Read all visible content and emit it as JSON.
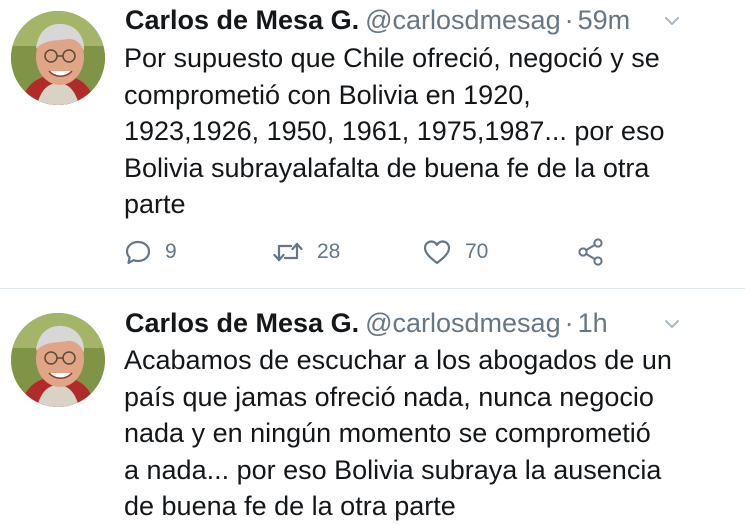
{
  "tweets": [
    {
      "author_name": "Carlos de Mesa G.",
      "handle": "@carlosdmesag",
      "separator": "·",
      "time": "59m",
      "text": "Por supuesto que Chile ofreció, negoció y se\ncomprometió con Bolivia en 1920,\n1923,1926, 1950, 1961, 1975,1987... por eso\nBolivia subrayalafalta de buena fe de la otra\nparte",
      "replies": "9",
      "retweets": "28",
      "likes": "70"
    },
    {
      "author_name": "Carlos de Mesa G.",
      "handle": "@carlosdmesag",
      "separator": "·",
      "time": "1h",
      "text": "Acabamos de escuchar a los abogados de un\npaís que jamas ofreció nada, nunca negocio\nnada y en ningún momento se comprometió\na nada... por eso Bolivia subraya la ausencia\nde buena fe de la otra parte"
    }
  ],
  "icons": {
    "reply": "reply-icon",
    "retweet": "retweet-icon",
    "like": "heart-icon",
    "share": "share-icon",
    "menu": "chevron-down-icon"
  },
  "colors": {
    "text": "#14171a",
    "secondary": "#657786",
    "divider": "#e1e8ed"
  }
}
